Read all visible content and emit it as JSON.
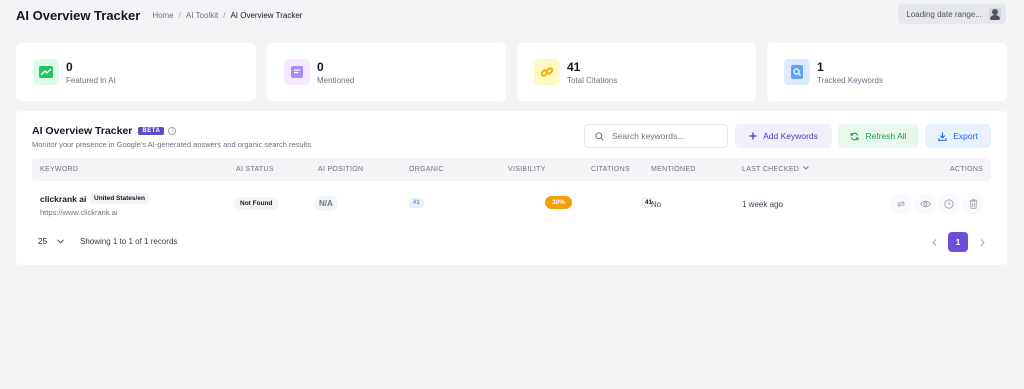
{
  "header": {
    "title": "AI Overview Tracker",
    "breadcrumb": [
      "Home",
      "AI Toolkit",
      "AI Overview Tracker"
    ],
    "date_range": "Loading date range..."
  },
  "stats": [
    {
      "value": "0",
      "label": "Featured in AI",
      "icon": "trend-chart-icon",
      "color": "#22c55e"
    },
    {
      "value": "0",
      "label": "Mentioned",
      "icon": "message-icon",
      "color": "#8b5cf6"
    },
    {
      "value": "41",
      "label": "Total Citations",
      "icon": "link-icon",
      "color": "#eab308"
    },
    {
      "value": "1",
      "label": "Tracked Keywords",
      "icon": "search-doc-icon",
      "color": "#3b82f6"
    }
  ],
  "panel": {
    "title": "AI Overview Tracker",
    "badge": "BETA",
    "subtitle": "Monitor your presence in Google's AI-generated answers and organic search results",
    "search_placeholder": "Search keywords...",
    "add_label": "Add Keywords",
    "refresh_label": "Refresh All",
    "export_label": "Export"
  },
  "table": {
    "columns": [
      "KEYWORD",
      "AI STATUS",
      "AI POSITION",
      "ORGANIC",
      "VISIBILITY",
      "CITATIONS",
      "MENTIONED",
      "LAST CHECKED",
      "ACTIONS"
    ],
    "rows": [
      {
        "keyword": "clickrank ai",
        "location": "United States/en",
        "url": "https://www.clickrank.ai",
        "ai_status": "Not Found",
        "ai_position": "N/A",
        "organic": "#1",
        "visibility": "30%",
        "citations": "41",
        "mentioned": "No",
        "last_checked": "1 week ago"
      }
    ]
  },
  "footer": {
    "page_size": "25",
    "records": "Showing 1 to 1 of 1 records",
    "current_page": "1"
  }
}
